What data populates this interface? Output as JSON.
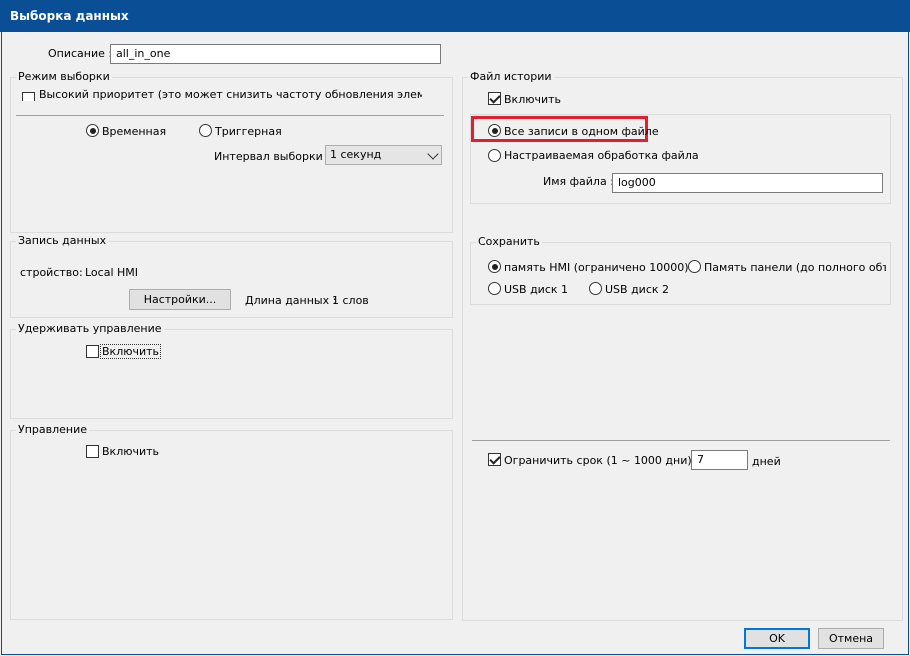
{
  "window": {
    "title": "Выборка данных"
  },
  "description": {
    "label": "Описание :",
    "value": "all_in_one"
  },
  "sampling_mode": {
    "group_label": "Режим выборки",
    "high_priority_label": "Высокий приоритет (это может снизить частоту обновления элементов экрана)",
    "high_priority_checked": false,
    "radio_time": "Временная",
    "radio_trigger": "Триггерная",
    "selected": "Временная",
    "interval_label": "Интервал выборки :",
    "interval_value": "1 секунд"
  },
  "data_record": {
    "group_label": "Запись данных",
    "device_label": "стройство:",
    "device_value": "Local HMI",
    "settings_button": "Настройки...",
    "length_label": "Длина данных :",
    "length_value": "1 слов"
  },
  "hold_control": {
    "group_label": "Удерживать управление",
    "enable_label": "Включить",
    "checked": false
  },
  "control": {
    "group_label": "Управление",
    "enable_label": "Включить",
    "checked": false
  },
  "history_file": {
    "group_label": "Файл истории",
    "enable_label": "Включить",
    "enable_checked": true,
    "radio_all_in_one": "Все записи в одном файле",
    "radio_custom": "Настраиваемая обработка файла",
    "selected": "Все записи в одном файле",
    "filename_label": "Имя файла :",
    "filename_value": "log000"
  },
  "save": {
    "group_label": "Сохранить",
    "option_hmi": "память HMI (ограничено 10000)",
    "option_panel": "Память панели (до полного объема)",
    "option_usb1": "USB диск 1",
    "option_usb2": "USB диск 2",
    "selected": "память HMI (ограничено 10000)"
  },
  "limit": {
    "label": "Ограничить срок (1 ~ 1000 дни)",
    "checked": true,
    "value": "7",
    "unit": "дней"
  },
  "buttons": {
    "ok": "OK",
    "cancel": "Отмена"
  },
  "colors": {
    "titlebar": "#0a4f96",
    "highlight": "#e02030",
    "default_button_border": "#0078d7"
  }
}
